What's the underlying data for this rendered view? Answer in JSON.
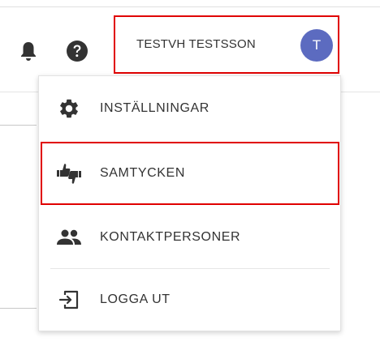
{
  "header": {
    "icons": {
      "notifications": "bell-icon",
      "help": "help-circle-icon"
    },
    "user": {
      "name": "TESTVH TESTSSON",
      "avatar_initial": "T",
      "avatar_color": "#5c6bc0"
    }
  },
  "user_dropdown": {
    "items": [
      {
        "label": "INSTÄLLNINGAR",
        "icon": "gear-icon"
      },
      {
        "label": "SAMTYCKEN",
        "icon": "thumbs-up-down-icon"
      },
      {
        "label": "KONTAKTPERSONER",
        "icon": "people-icon"
      },
      {
        "label": "LOGGA UT",
        "icon": "logout-icon"
      }
    ]
  },
  "colors": {
    "highlight": "#e00000",
    "icon": "#333333",
    "text": "#333333"
  }
}
